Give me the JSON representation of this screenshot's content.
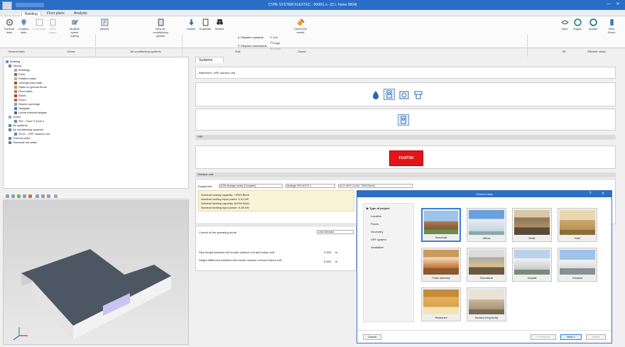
{
  "window": {
    "title": "CYPE SYSTEM FLEXTEC - 0000\\1.x - [C:\\. home 0004]",
    "minimize": "—",
    "close": "✕"
  },
  "menu_tabs": [
    "Building",
    "Floor plans",
    "Analysis"
  ],
  "ribbon": {
    "buttons": [
      "General data",
      "Location data",
      "Zone data",
      "Zone pages",
      "Multiple space editing",
      "Wizard",
      "New air conditioning system",
      "Delete",
      "Duplicate",
      "Search",
      "View",
      "Edges",
      "Update",
      "View Doors"
    ],
    "small_buttons": [
      "Displace upwards",
      "Displace downwards",
      "Cut",
      "Copy",
      "Paste",
      "Check the model"
    ],
    "groups": [
      "General data",
      "Zones",
      "Air conditioning systems",
      "Edit",
      "Zones",
      "3D",
      "Efficient views"
    ]
  },
  "tree": {
    "items": [
      "Building",
      "Library",
      "Buildings",
      "Ports",
      "Partition walls",
      "Underground walls",
      "Slabs on ground floors",
      "Floor slabs",
      "Roofs",
      "Doors",
      "Glazed openings",
      "Skylights",
      "Linear thermal bridges",
      "Zones",
      "Z01 - Floor 0 Zone 1",
      "Air systems",
      "Air conditioning systems",
      "SC01 - VRF outdoor unit",
      "Thermal units",
      "Domestic hot water"
    ]
  },
  "systems": {
    "tab": "Systems",
    "reference_label": "Reference: VRF outdoor unit",
    "section_label": "VRF",
    "brand": "FUJITSU",
    "outdoor_header": "Outdoor unit",
    "equipment_label": "Equipment",
    "equipment_values": [
      "AOW Airstage series (Complete)",
      "Airstage VRV-AOYX 1",
      "AJ-H 40TX 2 (HVL 72000 Btu/h)"
    ],
    "info_lines": [
      "Nominal cooling capacity: 72000 Btu/h",
      "Nominal cooling input power: 5.31 kW",
      "Nominal heating capacity: 81000 Btu/h",
      "Nominal heating input power: 5.38 kW"
    ],
    "control_label": "Control of the operating mode",
    "control_value": "Less intensive",
    "pipe_label": "Pipe length between the remote outdoor unit and indoor unit",
    "pipe_value": "0.000",
    "pipe_unit": "m",
    "height_label": "Height difference between the remote outdoor unit and indoor unit",
    "height_value": "0.000",
    "height_unit": "m"
  },
  "dialog": {
    "title": "General data",
    "nav": [
      "Type of project",
      "Location",
      "Floors",
      "Geometry",
      "VRF system",
      "Ventilation"
    ],
    "thumbs": [
      "Household",
      "Offices",
      "Retail",
      "Hotel",
      "Public assembly",
      "Educational",
      "Hospital",
      "Industrial",
      "Restaurant",
      "Sanitary living facility"
    ],
    "buttons": {
      "cancel": "Cancel",
      "previous": "< Previous",
      "next": "Next >",
      "finish": "Finish"
    }
  },
  "colors": {
    "accent": "#2e6fc5",
    "brand_red": "#e3141c"
  }
}
